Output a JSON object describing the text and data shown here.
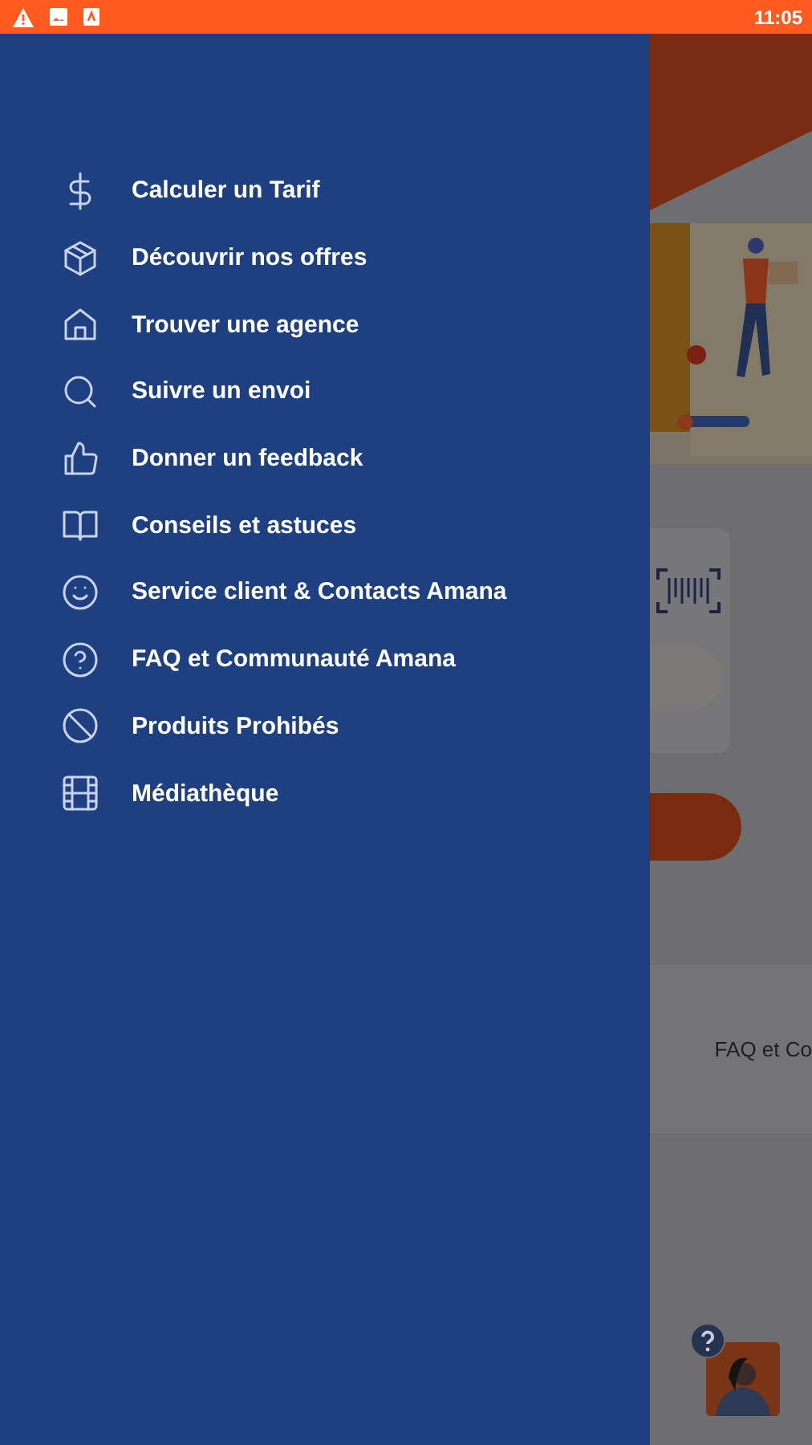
{
  "status_bar": {
    "time": "11:05"
  },
  "drawer": {
    "items": [
      {
        "kind": "dollar",
        "label": "Calculer un Tarif"
      },
      {
        "kind": "box",
        "label": "Découvrir nos offres"
      },
      {
        "kind": "home",
        "label": "Trouver une agence"
      },
      {
        "kind": "search",
        "label": "Suivre un envoi"
      },
      {
        "kind": "thumb",
        "label": "Donner un feedback"
      },
      {
        "kind": "book",
        "label": "Conseils et astuces"
      },
      {
        "kind": "smile",
        "label": "Service client & Contacts Amana"
      },
      {
        "kind": "help",
        "label": "FAQ et Communauté Amana"
      },
      {
        "kind": "forbidden",
        "label": "Produits Prohibés"
      },
      {
        "kind": "film",
        "label": "Médiathèque"
      }
    ]
  },
  "background": {
    "shortcut_label": "FAQ et Co"
  }
}
